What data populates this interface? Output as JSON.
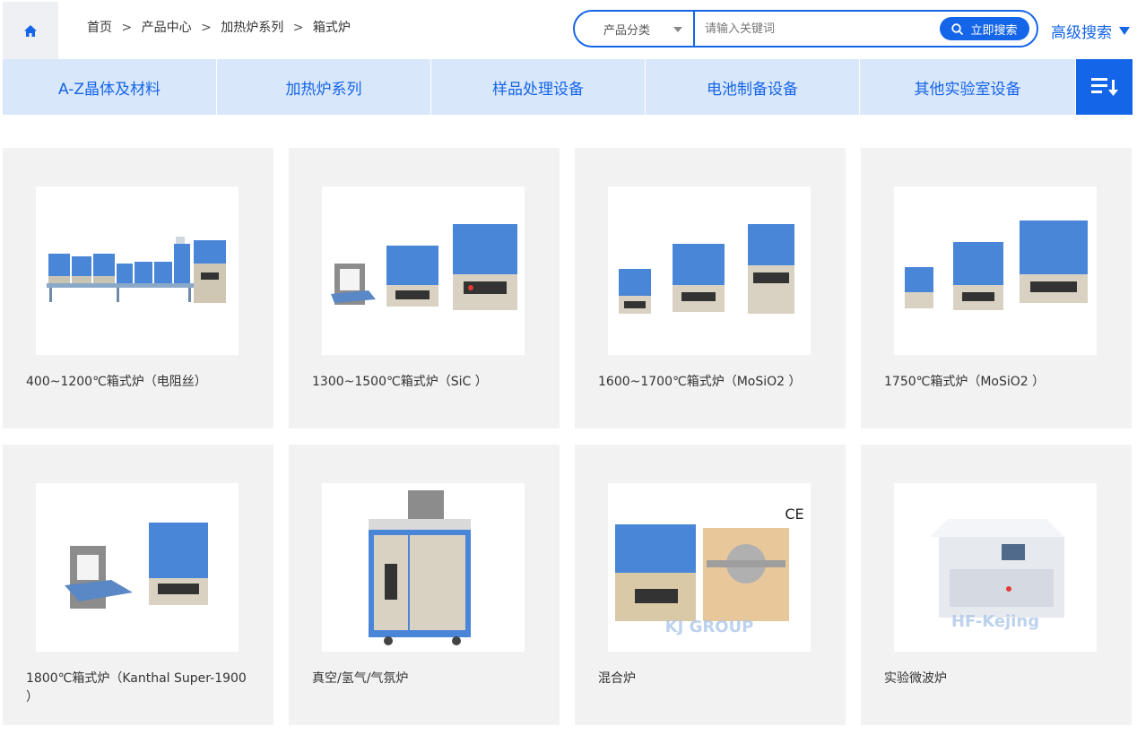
{
  "breadcrumb": [
    {
      "label": "首页"
    },
    {
      "label": "产品中心"
    },
    {
      "label": "加热炉系列"
    },
    {
      "label": "箱式炉"
    }
  ],
  "breadcrumb_separator": ">",
  "search": {
    "category_label": "产品分类",
    "placeholder": "请输入关键词",
    "button_label": "立即搜索",
    "advanced_label": "高级搜索"
  },
  "nav": {
    "items": [
      {
        "label": "A-Z晶体及材料"
      },
      {
        "label": "加热炉系列"
      },
      {
        "label": "样品处理设备"
      },
      {
        "label": "电池制备设备"
      },
      {
        "label": "其他实验室设备"
      }
    ]
  },
  "products": [
    {
      "title": "400~1200℃箱式炉（电阻丝）",
      "image": "multi-box-furnace-bench"
    },
    {
      "title": "1300~1500℃箱式炉（SiC ）",
      "image": "three-box-furnaces"
    },
    {
      "title": "1600~1700℃箱式炉（MoSiO2 ）",
      "image": "three-box-furnaces-tall"
    },
    {
      "title": "1750℃箱式炉（MoSiO2 ）",
      "image": "three-box-furnaces-wide"
    },
    {
      "title": "1800℃箱式炉（Kanthal Super-1900 ）",
      "image": "two-box-furnaces"
    },
    {
      "title": "真空/氢气/气氛炉",
      "image": "vacuum-cabinet-furnace"
    },
    {
      "title": "混合炉",
      "image": "hybrid-furnace"
    },
    {
      "title": "实验微波炉",
      "image": "lab-microwave-oven"
    }
  ],
  "colors": {
    "accent": "#1565e8",
    "nav_bg": "#d9e7fb",
    "card_bg": "#f2f2f2"
  }
}
